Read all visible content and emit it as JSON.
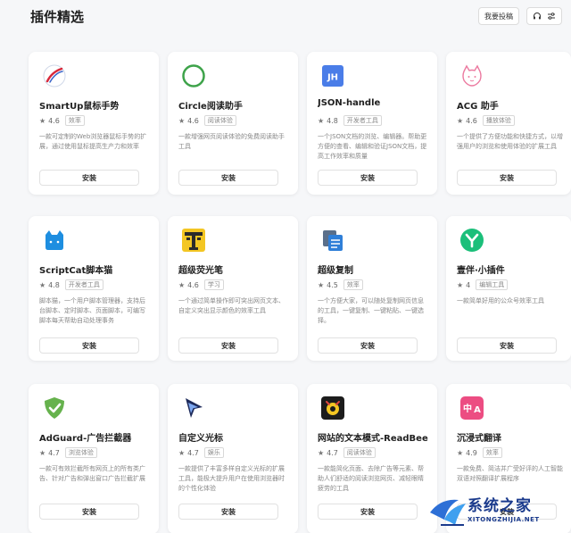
{
  "header": {
    "title": "插件精选",
    "submit_label": "我要投稿"
  },
  "install_label": "安装",
  "cards": [
    {
      "name": "SmartUp鼠标手势",
      "rating": "4.6",
      "tag": "效率",
      "desc": "一款可定制的Web浏览器鼠标手势的扩展，通过使用鼠标提高生产力和效率",
      "icon": "smartup-icon"
    },
    {
      "name": "Circle阅读助手",
      "rating": "4.6",
      "tag": "阅读体验",
      "desc": "一款增强网页阅读体验的免费阅读助手工具",
      "icon": "circle-icon"
    },
    {
      "name": "JSON-handle",
      "rating": "4.8",
      "tag": "开发者工具",
      "desc": "一个JSON文档的浏览、编辑器。帮助更方便的查看、编辑和验证JSON文档，提高工作效率和质量",
      "icon": "jh-icon"
    },
    {
      "name": "ACG 助手",
      "rating": "4.6",
      "tag": "播放体验",
      "desc": "一个提供了方便功能和快捷方式，以增强用户的浏览和使用体验的扩展工具",
      "icon": "cat-outline-icon"
    },
    {
      "name": "ScriptCat脚本猫",
      "rating": "4.8",
      "tag": "开发者工具",
      "desc": "脚本猫，一个用户脚本管理器，支持后台脚本、定时脚本、页面脚本，可编写脚本每天帮助自动处理事务",
      "icon": "scriptcat-icon"
    },
    {
      "name": "超级荧光笔",
      "rating": "4.6",
      "tag": "学习",
      "desc": "一个通过简单操作即可突出网页文本、自定义突出显示颜色的效率工具",
      "icon": "highlighter-icon"
    },
    {
      "name": "超级复制",
      "rating": "4.5",
      "tag": "效率",
      "desc": "一个方便大家，可以随处复制网页信息的工具，一键复制、一键粘贴、一键选择。",
      "icon": "copy-icon"
    },
    {
      "name": "壹伴·小插件",
      "rating": "4",
      "tag": "编辑工具",
      "desc": "一款简单好用的公众号效率工具",
      "icon": "yiban-icon"
    },
    {
      "name": "AdGuard-广告拦截器",
      "rating": "4.7",
      "tag": "浏览体验",
      "desc": "一款可有效拦截所有网页上的所有类广告、针对广告和弹出窗口广告拦截扩展",
      "icon": "shield-check-icon"
    },
    {
      "name": "自定义光标",
      "rating": "4.7",
      "tag": "娱乐",
      "desc": "一款提供了丰富多样自定义光标的扩展工具，能极大提升用户在使用浏览器时的个性化体验",
      "icon": "cursor-icon"
    },
    {
      "name": "网站的文本模式-ReadBee",
      "rating": "4.7",
      "tag": "阅读体验",
      "desc": "一款能简化页面、去除广告等元素、帮助人们舒适的阅读浏览网页、减轻眼睛疲劳的工具",
      "icon": "readbee-icon"
    },
    {
      "name": "沉浸式翻译",
      "rating": "4.9",
      "tag": "效率",
      "desc": "一款免费、简洁并广受好评的人工智能双语对照翻译扩展程序",
      "icon": "translate-icon"
    }
  ],
  "watermark": {
    "main": "系统之家",
    "sub": "XITONGZHIJIA.NET"
  },
  "colors": {
    "jh_blue": "#4a7de8",
    "circle_green": "#3ea34a",
    "scriptcat_blue": "#1e8ee0",
    "highlighter_yellow": "#f3c623",
    "yiban_green": "#1bbf7a",
    "adguard_green": "#66b24d",
    "translate_pink": "#ec4d82"
  }
}
